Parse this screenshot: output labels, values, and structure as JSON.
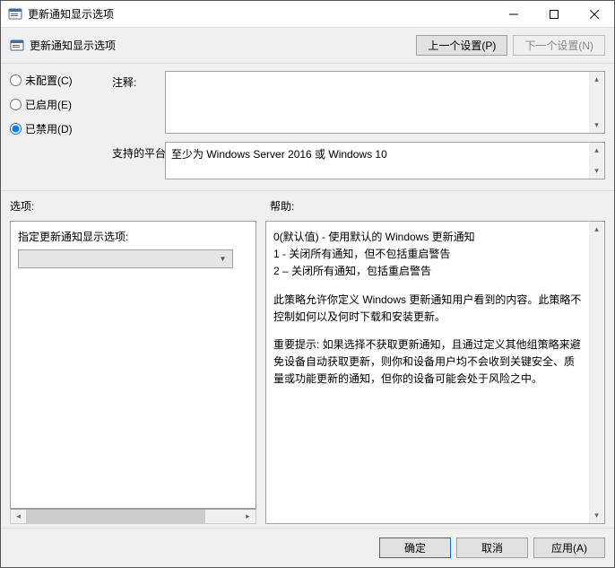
{
  "window": {
    "title": "更新通知显示选项"
  },
  "header": {
    "title": "更新通知显示选项",
    "prev_btn": "上一个设置(P)",
    "next_btn": "下一个设置(N)"
  },
  "radios": {
    "not_configured": "未配置(C)",
    "enabled": "已启用(E)",
    "disabled": "已禁用(D)",
    "selected": "disabled"
  },
  "labels": {
    "comment": "注释:",
    "supported": "支持的平台:",
    "options": "选项:",
    "help": "帮助:"
  },
  "comment_text": "",
  "supported_text": "至少为 Windows Server 2016 或 Windows 10",
  "options": {
    "label": "指定更新通知显示选项:",
    "value": ""
  },
  "help": {
    "line1": "0(默认值) - 使用默认的 Windows 更新通知",
    "line2": "1 - 关闭所有通知，但不包括重启警告",
    "line3": "2 – 关闭所有通知，包括重启警告",
    "para1": "此策略允许你定义 Windows 更新通知用户看到的内容。此策略不控制如何以及何时下载和安装更新。",
    "para2": "重要提示: 如果选择不获取更新通知，且通过定义其他组策略来避免设备自动获取更新，则你和设备用户均不会收到关键安全、质量或功能更新的通知，但你的设备可能会处于风险之中。"
  },
  "footer": {
    "ok": "确定",
    "cancel": "取消",
    "apply": "应用(A)"
  }
}
